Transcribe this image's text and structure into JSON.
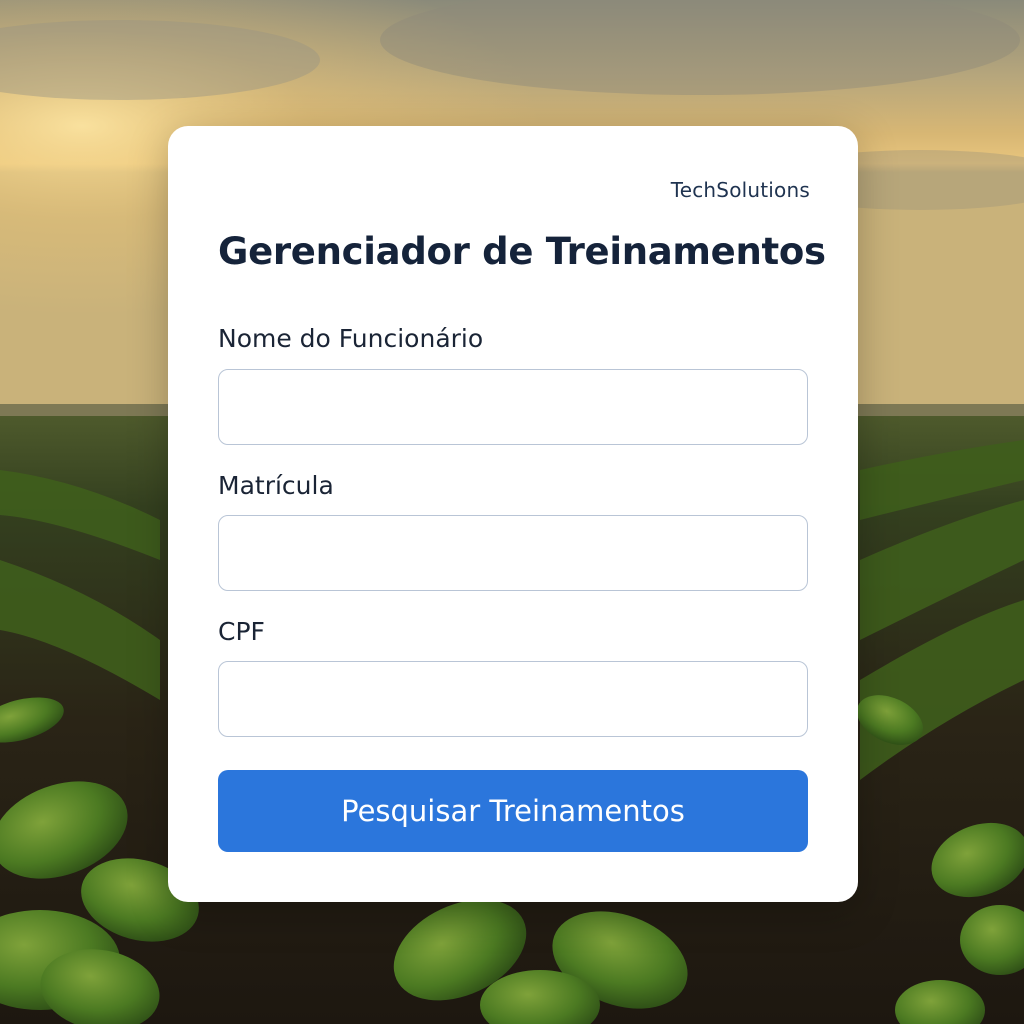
{
  "brand": {
    "name": "TechSolutions"
  },
  "form": {
    "title": "Gerenciador de Treinamentos",
    "fields": [
      {
        "label": "Nome do Funcionário",
        "value": "",
        "placeholder": ""
      },
      {
        "label": "Matrícula",
        "value": "",
        "placeholder": ""
      },
      {
        "label": "CPF",
        "value": "",
        "placeholder": ""
      }
    ],
    "submit_label": "Pesquisar Treinamentos"
  },
  "colors": {
    "primary_button": "#2b76dc",
    "card_background": "#ffffff",
    "title_text": "#15233a"
  },
  "background": {
    "scene": "crop-field-at-sunset"
  }
}
